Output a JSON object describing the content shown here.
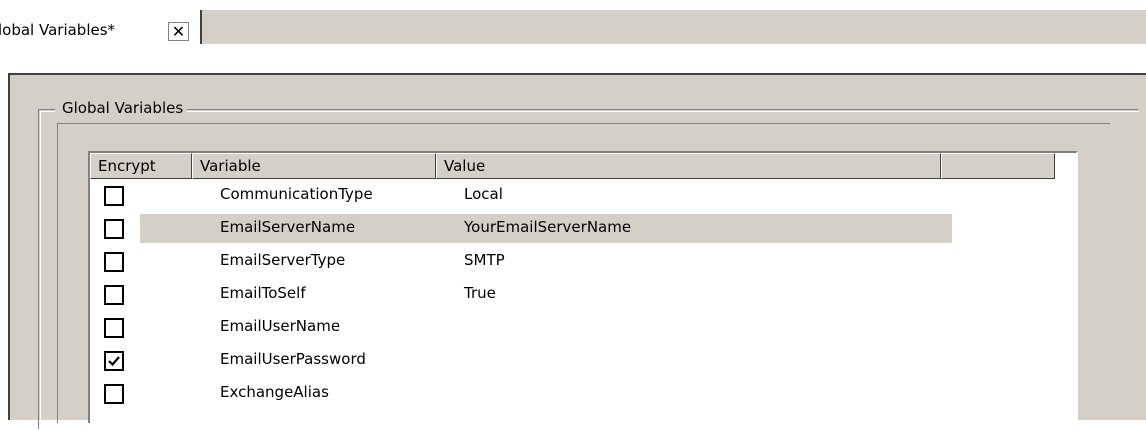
{
  "tab": {
    "title": "lobal Variables*",
    "close_glyph": "✕"
  },
  "groupbox": {
    "title": "Global Variables"
  },
  "table": {
    "columns": [
      "Encrypt",
      "Variable",
      "Value",
      ""
    ],
    "rows": [
      {
        "encrypt": false,
        "variable": "CommunicationType",
        "value": "Local",
        "highlighted": false
      },
      {
        "encrypt": false,
        "variable": "EmailServerName",
        "value": "YourEmailServerName",
        "highlighted": true
      },
      {
        "encrypt": false,
        "variable": "EmailServerType",
        "value": "SMTP",
        "highlighted": false
      },
      {
        "encrypt": false,
        "variable": "EmailToSelf",
        "value": "True",
        "highlighted": false
      },
      {
        "encrypt": false,
        "variable": "EmailUserName",
        "value": "",
        "highlighted": false
      },
      {
        "encrypt": true,
        "variable": "EmailUserPassword",
        "value": "",
        "highlighted": false
      },
      {
        "encrypt": false,
        "variable": "ExchangeAlias",
        "value": "",
        "highlighted": false
      }
    ]
  },
  "colors": {
    "face": "#d4d0c8",
    "shadow": "#808080",
    "dark_shadow": "#404040",
    "highlight": "#ffffff"
  },
  "icons": {
    "close": "close-icon",
    "checkbox_checked": "checkmark-icon"
  }
}
